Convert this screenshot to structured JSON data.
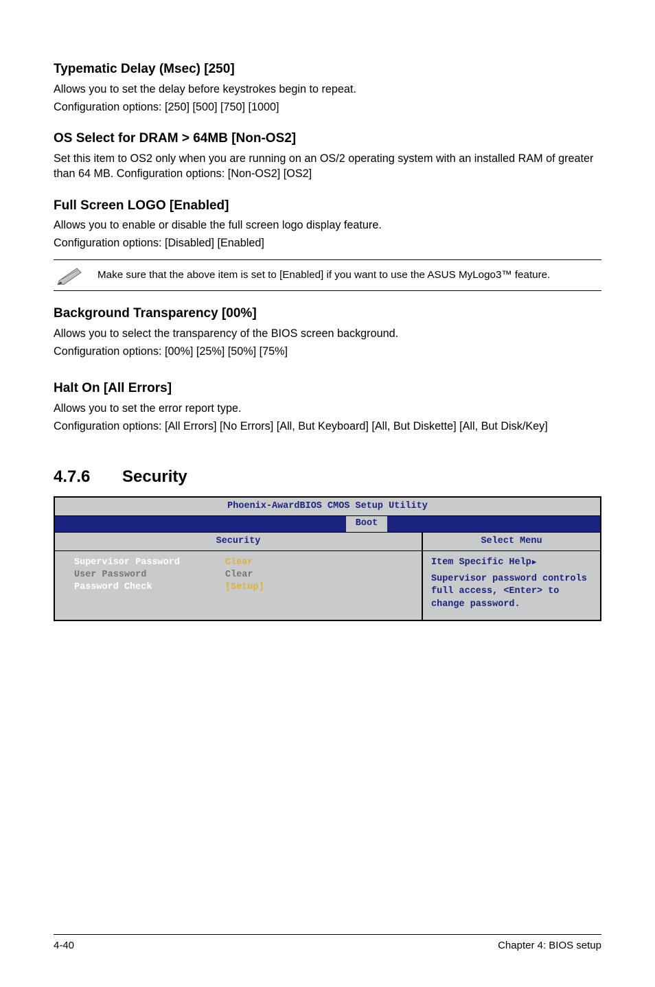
{
  "s1": {
    "h": "Typematic Delay (Msec) [250]",
    "p1": "Allows you to set the delay before keystrokes begin to repeat.",
    "p2": "Configuration options: [250] [500] [750] [1000]"
  },
  "s2": {
    "h": "OS Select for DRAM > 64MB [Non-OS2]",
    "p1": "Set this item to OS2 only when you are running on an OS/2 operating system with an installed RAM of greater than 64 MB. Configuration options: [Non-OS2] [OS2]"
  },
  "s3": {
    "h": "Full Screen LOGO [Enabled]",
    "p1": "Allows you to enable or disable the full screen logo display feature.",
    "p2": "Configuration options: [Disabled] [Enabled]"
  },
  "note": {
    "text": "Make sure that the above item is set to [Enabled] if you want to use the ASUS MyLogo3™ feature."
  },
  "s4": {
    "h": "Background Transparency [00%]",
    "p1": "Allows you to select the transparency of the BIOS screen background.",
    "p2": "Configuration options: [00%] [25%] [50%] [75%]"
  },
  "s5": {
    "h": "Halt On [All Errors]",
    "p1": "Allows you to set the error report type.",
    "p2": "Configuration options: [All Errors] [No Errors] [All, But Keyboard] [All, But Diskette] [All, But Disk/Key]"
  },
  "sec": {
    "num": "4.7.6",
    "title": "Security"
  },
  "bios": {
    "title": "Phoenix-AwardBIOS CMOS Setup Utility",
    "menu_boot": "Boot",
    "left_head": "Security",
    "right_head": "Select Menu",
    "rows": [
      {
        "label": "Supervisor Password",
        "val": "Clear"
      },
      {
        "label": "User Password",
        "val": "Clear"
      },
      {
        "label": "Password Check",
        "val": "[Setup]"
      }
    ],
    "help_title": "Item Specific Help",
    "help_body": "Supervisor password controls full access, <Enter> to change password."
  },
  "footer": {
    "left": "4-40",
    "right": "Chapter 4: BIOS setup"
  }
}
